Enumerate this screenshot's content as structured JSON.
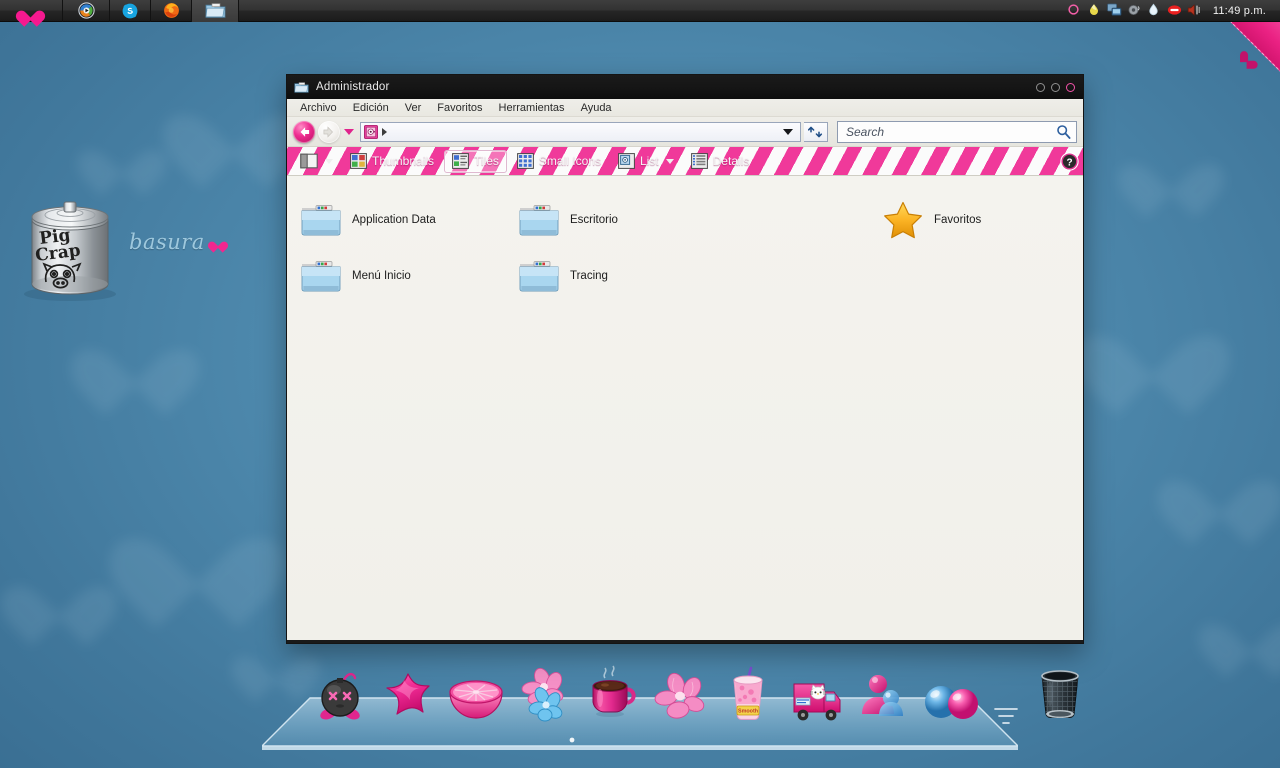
{
  "desktop": {
    "background_color": "#4a87ad",
    "accent_pink": "#ee2c90",
    "trash": {
      "name": "desktop-trash-can",
      "can_text_line1": "Pig",
      "can_text_line2": "Crap",
      "label": "basura"
    }
  },
  "topbar": {
    "background_color": "#2b2b2b",
    "logo": "pink-heart-logo",
    "launchers": [
      {
        "name": "media-player",
        "icon": "media-player-icon"
      },
      {
        "name": "skype",
        "icon": "skype-icon"
      },
      {
        "name": "firefox",
        "icon": "firefox-icon"
      },
      {
        "name": "file-manager",
        "icon": "folder-icon",
        "active": true
      }
    ],
    "tray": [
      {
        "name": "record-indicator",
        "icon": "circle-outline-icon"
      },
      {
        "name": "color-picker",
        "icon": "droplet-yellow-icon"
      },
      {
        "name": "network",
        "icon": "network-monitor-icon"
      },
      {
        "name": "sound-settings",
        "icon": "speaker-grey-icon"
      },
      {
        "name": "water-drop",
        "icon": "droplet-white-icon"
      },
      {
        "name": "do-not-disturb",
        "icon": "no-entry-icon"
      },
      {
        "name": "volume",
        "icon": "volume-icon"
      }
    ],
    "clock": "11:49 p.m."
  },
  "ribbon": {
    "name": "corner-ribbon",
    "icon": "heart-icon"
  },
  "window": {
    "title": "Administrador",
    "title_icon": "folder-icon",
    "controls": [
      {
        "name": "minimize-button",
        "color": "#8f8f8f"
      },
      {
        "name": "maximize-button",
        "color": "#8f8f8f"
      },
      {
        "name": "close-button",
        "color": "#f253a8"
      }
    ],
    "menu": [
      {
        "label": "Archivo"
      },
      {
        "label": "Edición"
      },
      {
        "label": "Ver"
      },
      {
        "label": "Favoritos"
      },
      {
        "label": "Herramientas"
      },
      {
        "label": "Ayuda"
      }
    ],
    "nav": {
      "back_label": "Back",
      "forward_label": "Forward",
      "history_label": "Recent pages",
      "address_icon": "safe-vault-icon",
      "address_value": "",
      "refresh_label": "Refresh"
    },
    "search": {
      "placeholder": "Search",
      "value": "",
      "icon": "search-icon"
    },
    "view_toolbar": {
      "items": [
        {
          "label": "",
          "icon": "view-pane-icon",
          "has_chevron": true,
          "active": false
        },
        {
          "label": "Thumbnails",
          "icon": "thumbnails-icon",
          "has_chevron": false,
          "active": false
        },
        {
          "label": "Tiles",
          "icon": "tiles-icon",
          "has_chevron": false,
          "active": true
        },
        {
          "label": "Small Icons",
          "icon": "small-icons-icon",
          "has_chevron": false,
          "active": false
        },
        {
          "label": "List",
          "icon": "list-icon",
          "has_chevron": true,
          "active": false
        },
        {
          "label": "Details",
          "icon": "details-icon",
          "has_chevron": false,
          "active": false
        }
      ],
      "help_label": "Help"
    },
    "files": [
      {
        "name": "Application Data",
        "icon": "folder-icon"
      },
      {
        "name": "Escritorio",
        "icon": "folder-icon"
      },
      {
        "name": "Favoritos",
        "icon": "star-icon"
      },
      {
        "name": "Menú Inicio",
        "icon": "folder-icon"
      },
      {
        "name": "Tracing",
        "icon": "folder-icon"
      }
    ]
  },
  "dock": {
    "items": [
      {
        "name": "bomb",
        "icon": "bomb-icon"
      },
      {
        "name": "star",
        "icon": "pink-star-icon"
      },
      {
        "name": "grapefruit",
        "icon": "grapefruit-icon"
      },
      {
        "name": "flowers",
        "icon": "flowers-icon"
      },
      {
        "name": "coffee",
        "icon": "coffee-cup-icon"
      },
      {
        "name": "flower",
        "icon": "pink-flower-icon"
      },
      {
        "name": "smoothie",
        "icon": "smoothie-cup-icon"
      },
      {
        "name": "kitty-truck",
        "icon": "kitty-truck-icon"
      },
      {
        "name": "messenger",
        "icon": "contacts-icon"
      },
      {
        "name": "balls",
        "icon": "two-balls-icon"
      },
      {
        "name": "separator",
        "icon": "separator-icon"
      },
      {
        "name": "trash",
        "icon": "mesh-trash-icon"
      }
    ]
  }
}
